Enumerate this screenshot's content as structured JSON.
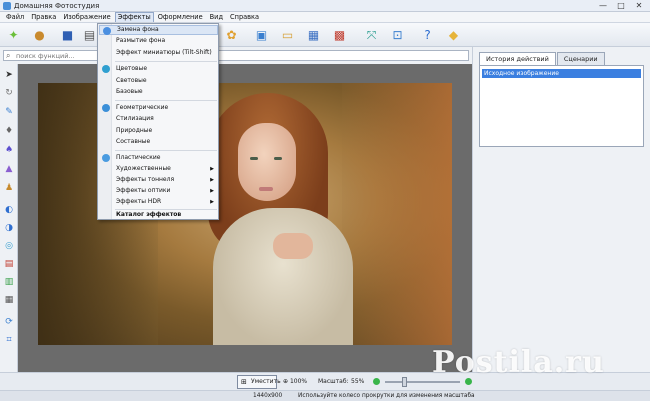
{
  "window": {
    "title": "Домашняя Фотостудия",
    "buttons": [
      "—",
      "□",
      "✕"
    ]
  },
  "menubar": {
    "items": [
      "Файл",
      "Правка",
      "Изображение",
      "Эффекты",
      "Оформление",
      "Вид",
      "Справка"
    ],
    "active": "Эффекты"
  },
  "search": {
    "placeholder": "поиск функций..."
  },
  "effects_menu": {
    "items": [
      {
        "label": "Замена фона",
        "highlighted": true
      },
      {
        "label": "Размытие фона"
      },
      {
        "label": "Эффект миниатюры (Tilt-Shift)"
      },
      {
        "label": "Цветовые"
      },
      {
        "label": "Световые"
      },
      {
        "label": "Базовые"
      },
      {
        "label": "Геометрические"
      },
      {
        "label": "Стилизация"
      },
      {
        "label": "Природные"
      },
      {
        "label": "Составные"
      },
      {
        "label": "Пластические"
      },
      {
        "label": "Художественные",
        "submenu": true
      },
      {
        "label": "Эффекты тоннеля",
        "submenu": true
      },
      {
        "label": "Эффекты оптики",
        "submenu": true
      },
      {
        "label": "Эффекты HDR",
        "submenu": true
      },
      {
        "label": "Каталог эффектов",
        "bold": true
      }
    ]
  },
  "right_panel": {
    "tabs": [
      "История действий",
      "Сценарии"
    ],
    "active_tab": "История действий",
    "history": [
      "Исходное изображение"
    ]
  },
  "bottom": {
    "fit_label": "Уместить",
    "zoom_100_label": "100%",
    "zoom_label": "Масштаб:",
    "zoom_value": "55%",
    "zoom_level_pct": 55
  },
  "status": {
    "dimensions": "1440x900",
    "hint": "Используйте колесо прокрутки для изменения масштаба"
  },
  "watermark": "Postila.ru",
  "colors": {
    "accent": "#3b7fe0",
    "zoom_buttons": "#39b54a"
  }
}
